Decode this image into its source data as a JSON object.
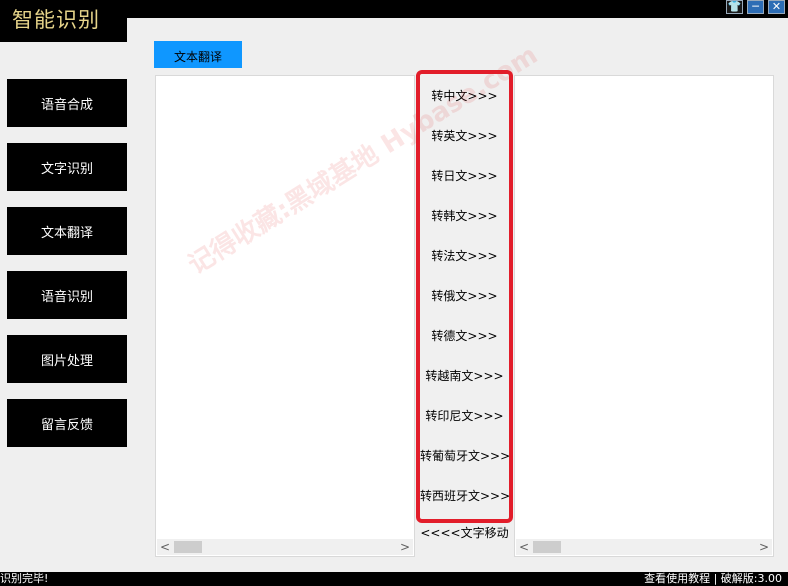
{
  "app": {
    "title": "智能识别"
  },
  "window_buttons": {
    "skin": "👕",
    "minimize": "─",
    "close": "✕"
  },
  "sidebar": {
    "items": [
      {
        "label": "语音合成"
      },
      {
        "label": "文字识别"
      },
      {
        "label": "文本翻译"
      },
      {
        "label": "语音识别"
      },
      {
        "label": "图片处理"
      },
      {
        "label": "留言反馈"
      }
    ]
  },
  "tab": {
    "label": "文本翻译"
  },
  "converters": [
    "转中文>>>",
    "转英文>>>",
    "转日文>>>",
    "转韩文>>>",
    "转法文>>>",
    "转俄文>>>",
    "转德文>>>",
    "转越南文>>>",
    "转印尼文>>>",
    "转葡萄牙文>>>",
    "转西班牙文>>>"
  ],
  "move_button": "<<<<文字移动",
  "scroll": {
    "left": "<",
    "right": ">"
  },
  "watermark": {
    "text": "记得收藏:黑域基地 Hybase.com"
  },
  "status": {
    "left": "识别完毕!",
    "tutorial": "查看使用教程",
    "separator": "|",
    "version": "破解版:3.00"
  },
  "accent_colors": {
    "tab_blue": "#0f97ff",
    "highlight_red": "#e21d2a",
    "title_gold": "#e6d48a"
  }
}
